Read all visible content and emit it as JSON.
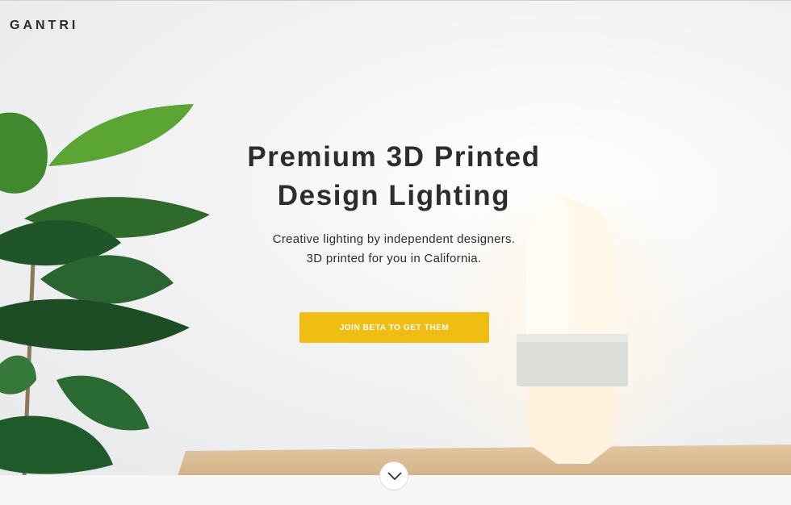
{
  "brand": {
    "logo_text": "GANTRI"
  },
  "hero": {
    "headline_line1": "Premium 3D Printed",
    "headline_line2": "Design Lighting",
    "subtext_line1": "Creative lighting by independent designers.",
    "subtext_line2": "3D printed for you in California.",
    "cta_label": "JOIN BETA TO GET THEM"
  },
  "icons": {
    "scroll": "chevron-down-icon"
  },
  "colors": {
    "cta": "#f0bd12",
    "text": "#2d2d2d"
  }
}
